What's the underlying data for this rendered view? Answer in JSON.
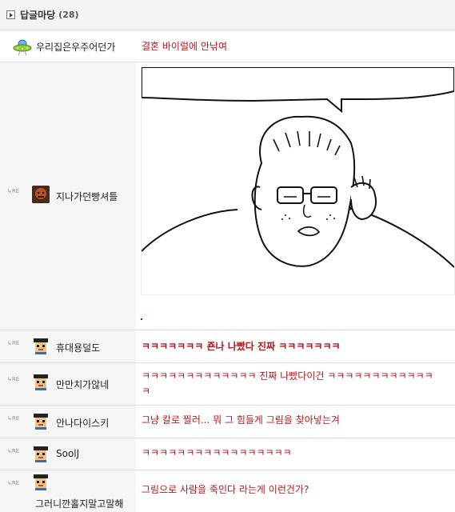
{
  "header": {
    "title": "답글마당",
    "count": "(28)"
  },
  "comments": [
    {
      "id": "c0",
      "nick": "우리집은우주어던가",
      "text": "결혼 바이럴에 안낚여",
      "reply": false,
      "avatar": "ufo"
    },
    {
      "id": "c1",
      "nick": "지나가던빵셔틀",
      "text": "",
      "reply": true,
      "avatar": "photo",
      "image": true,
      "image_alt": "comic-drawing"
    },
    {
      "id": "c2",
      "nick": "휴대용덜도",
      "text": "ㅋㅋㅋㅋㅋㅋㅋ 죤나 나빴다 진짜 ㅋㅋㅋㅋㅋㅋㅋ",
      "reply": true,
      "avatar": "pixel",
      "bold": true
    },
    {
      "id": "c3",
      "nick": "만만치가않네",
      "text": "ㅋㅋㅋㅋㅋㅋㅋㅋㅋㅋㅋㅋㅋ 진짜 나빴다이건 ㅋㅋㅋㅋㅋㅋㅋㅋㅋㅋㅋㅋ",
      "text2": "ㅋ",
      "reply": true,
      "avatar": "pixel"
    },
    {
      "id": "c4",
      "nick": "안나다이스키",
      "text": "그냥 칼로 찔러... 뭐 그 힘들게 그림을 찾아넣는겨",
      "reply": true,
      "avatar": "pixel"
    },
    {
      "id": "c5",
      "nick": "SoolJ",
      "text": "ㅋㅋㅋㅋㅋㅋㅋㅋㅋㅋㅋㅋㅋㅋㅋㅋㅋ",
      "reply": true,
      "avatar": "pixel"
    },
    {
      "id": "c6",
      "nick": "그러니깐홀지말고말해",
      "text": "그림으로 사람을 죽인다 라는게 이런건가?",
      "reply": true,
      "avatar": "pixel"
    }
  ],
  "reply_marker": "RE",
  "colors": {
    "accent": "#b5161b",
    "row_bg": "#f5f5f5",
    "border": "#dedede"
  }
}
